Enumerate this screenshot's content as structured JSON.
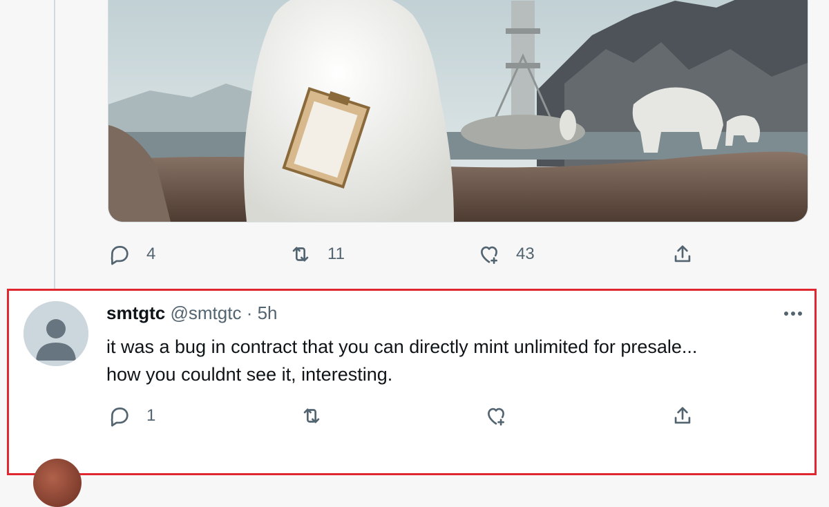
{
  "original_tweet": {
    "actions": {
      "reply_count": "4",
      "retweet_count": "11",
      "like_count": "43",
      "share_count": ""
    }
  },
  "reply": {
    "display_name": "smtgtc",
    "handle": "@smtgtc",
    "separator": "·",
    "timestamp": "5h",
    "text_line1": "it was a bug in contract that you can directly mint unlimited for presale...",
    "text_line2": "how you couldnt see it, interesting.",
    "actions": {
      "reply_count": "1",
      "retweet_count": "",
      "like_count": "",
      "share_count": ""
    },
    "highlight_color": "#e0262e"
  },
  "icons": [
    "reply-icon",
    "retweet-icon",
    "like-icon",
    "share-icon",
    "more-icon",
    "default-avatar-icon"
  ],
  "colors": {
    "secondary_text": "#536471",
    "primary_text": "#0f1419",
    "border": "#cfd9de"
  }
}
